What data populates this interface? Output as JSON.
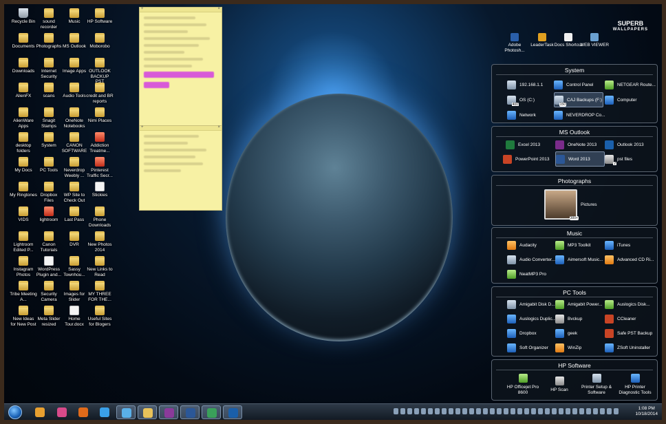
{
  "brand": {
    "line1": "SUPERB",
    "line2": "WALLPAPERS"
  },
  "desktop_icons": [
    {
      "label": "Recycle Bin",
      "icon": "recycle-bin-icon",
      "kind": "bin"
    },
    {
      "label": "sound recorder",
      "icon": "folder-icon",
      "kind": "folder"
    },
    {
      "label": "Music",
      "icon": "folder-icon",
      "kind": "folder"
    },
    {
      "label": "HP Software",
      "icon": "folder-icon",
      "kind": "folder"
    },
    {
      "label": "Documents",
      "icon": "folder-icon",
      "kind": "folder"
    },
    {
      "label": "Photographs",
      "icon": "folder-icon",
      "kind": "folder"
    },
    {
      "label": "MS Outlook",
      "icon": "folder-icon",
      "kind": "folder"
    },
    {
      "label": "Moborobo",
      "icon": "folder-icon",
      "kind": "folder"
    },
    {
      "label": "Downloads",
      "icon": "folder-icon",
      "kind": "folder"
    },
    {
      "label": "Internet Security",
      "icon": "folder-icon",
      "kind": "folder"
    },
    {
      "label": "Image Apps",
      "icon": "folder-icon",
      "kind": "folder"
    },
    {
      "label": "OUTLOOK BACKUP PST",
      "icon": "folder-icon",
      "kind": "folder"
    },
    {
      "label": "AlienFX",
      "icon": "folder-icon",
      "kind": "folder"
    },
    {
      "label": "scans",
      "icon": "folder-icon",
      "kind": "folder"
    },
    {
      "label": "Audio Tools",
      "icon": "folder-icon",
      "kind": "folder"
    },
    {
      "label": "credit and BR reports",
      "icon": "folder-icon",
      "kind": "folder"
    },
    {
      "label": "AlienWare Apps",
      "icon": "folder-icon",
      "kind": "folder"
    },
    {
      "label": "Snagit Stamps",
      "icon": "folder-icon",
      "kind": "folder"
    },
    {
      "label": "OneNote Notebooks",
      "icon": "folder-icon",
      "kind": "folder"
    },
    {
      "label": "Nimi Places",
      "icon": "folder-icon",
      "kind": "folder"
    },
    {
      "label": "desktop folders",
      "icon": "folder-icon",
      "kind": "folder"
    },
    {
      "label": "System",
      "icon": "folder-icon",
      "kind": "folder"
    },
    {
      "label": "CANON SOFTWARE",
      "icon": "folder-icon",
      "kind": "folder"
    },
    {
      "label": "Addiction Treatme...",
      "icon": "chrome-icon",
      "kind": "red"
    },
    {
      "label": "My Docs",
      "icon": "folder-icon",
      "kind": "folder"
    },
    {
      "label": "PC Tools",
      "icon": "folder-icon",
      "kind": "folder"
    },
    {
      "label": "Neverdrop Weebly ...",
      "icon": "folder-icon",
      "kind": "folder"
    },
    {
      "label": "Pinterest Traffic Secr...",
      "icon": "chrome-icon",
      "kind": "red"
    },
    {
      "label": "My Ringtones",
      "icon": "folder-icon",
      "kind": "folder"
    },
    {
      "label": "Dropbox Files",
      "icon": "folder-icon",
      "kind": "folder"
    },
    {
      "label": "WP Site to Check Out",
      "icon": "folder-icon",
      "kind": "folder"
    },
    {
      "label": "Stickies",
      "icon": "stickies-icon",
      "kind": "doc"
    },
    {
      "label": "VIDS",
      "icon": "folder-icon",
      "kind": "folder"
    },
    {
      "label": "lightroom",
      "icon": "lightroom-icon",
      "kind": "red"
    },
    {
      "label": "Last Pass",
      "icon": "folder-icon",
      "kind": "folder"
    },
    {
      "label": "Phone Downloads",
      "icon": "folder-icon",
      "kind": "folder"
    },
    {
      "label": "Lightroom Edited P...",
      "icon": "folder-icon",
      "kind": "folder"
    },
    {
      "label": "Canon Tutorials",
      "icon": "folder-icon",
      "kind": "folder"
    },
    {
      "label": "DVR",
      "icon": "folder-icon",
      "kind": "folder"
    },
    {
      "label": "New Photos 2014",
      "icon": "folder-icon",
      "kind": "folder"
    },
    {
      "label": "Instagram Photos",
      "icon": "folder-icon",
      "kind": "folder"
    },
    {
      "label": "WordPress Plugin and...",
      "icon": "document-icon",
      "kind": "doc"
    },
    {
      "label": "Sassy Townhou...",
      "icon": "folder-icon",
      "kind": "folder"
    },
    {
      "label": "New Links to Read",
      "icon": "folder-icon",
      "kind": "folder"
    },
    {
      "label": "Tribe Meeting A...",
      "icon": "folder-icon",
      "kind": "folder"
    },
    {
      "label": "Security Camera",
      "icon": "folder-icon",
      "kind": "folder"
    },
    {
      "label": "Images for Slider",
      "icon": "folder-icon",
      "kind": "folder"
    },
    {
      "label": "MY THREE FOR THE...",
      "icon": "folder-icon",
      "kind": "folder"
    },
    {
      "label": "New Ideas for New Post",
      "icon": "folder-icon",
      "kind": "folder"
    },
    {
      "label": "Meta Slider resized",
      "icon": "folder-icon",
      "kind": "folder"
    },
    {
      "label": "Home Tour.docx",
      "icon": "word-doc-icon",
      "kind": "doc"
    },
    {
      "label": "Useful Sites for Blogers",
      "icon": "folder-icon",
      "kind": "folder"
    }
  ],
  "top_shortcuts": [
    {
      "label": "Adobe Photosh...",
      "icon": "photoshop-icon"
    },
    {
      "label": "LeaderTask",
      "icon": "leadertask-icon"
    },
    {
      "label": "Docs Shortcut",
      "icon": "docs-icon"
    },
    {
      "label": "WEB VIEWER",
      "icon": "web-viewer-icon"
    }
  ],
  "fences": {
    "system": {
      "title": "System",
      "items": [
        {
          "label": "192.168.1.1",
          "icon": "network-address-icon",
          "kind": "gen"
        },
        {
          "label": "Control Panel",
          "icon": "control-panel-icon",
          "kind": "blue"
        },
        {
          "label": "NETGEAR Route...",
          "icon": "netgear-icon",
          "kind": "green"
        },
        {
          "label": "OS (C:)",
          "icon": "drive-icon",
          "kind": "gen",
          "badge": "400"
        },
        {
          "label": "CAJ Backups (F:)",
          "icon": "drive-icon",
          "kind": "gen",
          "badge": "150",
          "selected": true
        },
        {
          "label": "Computer",
          "icon": "computer-icon",
          "kind": "blue"
        },
        {
          "label": "Network",
          "icon": "network-icon",
          "kind": "blue"
        },
        {
          "label": "NEVERDROP Co...",
          "icon": "neverdrop-icon",
          "kind": "blue"
        }
      ]
    },
    "outlook": {
      "title": "MS Outlook",
      "items": [
        {
          "label": "Excel 2013",
          "icon": "excel-icon",
          "kind": "xl"
        },
        {
          "label": "OneNote 2013",
          "icon": "onenote-icon",
          "kind": "on"
        },
        {
          "label": "Outlook 2013",
          "icon": "outlook-icon",
          "kind": "ol"
        },
        {
          "label": "PowerPoint 2013",
          "icon": "powerpoint-icon",
          "kind": "pp"
        },
        {
          "label": "Word 2013",
          "icon": "word-icon",
          "kind": "wd",
          "selected": true
        },
        {
          "label": "pst files",
          "icon": "pst-files-icon",
          "kind": "gray",
          "badge": "2"
        }
      ]
    },
    "photographs": {
      "title": "Photographs",
      "items": [
        {
          "label": "Pictures",
          "icon": "pictures-icon",
          "kind": "thumb",
          "badge": "300+"
        }
      ]
    },
    "music": {
      "title": "Music",
      "items": [
        {
          "label": "Audacity",
          "icon": "audacity-icon",
          "kind": "orange"
        },
        {
          "label": "MP3 Toolkit",
          "icon": "mp3-toolkit-icon",
          "kind": "green"
        },
        {
          "label": "iTunes",
          "icon": "itunes-icon",
          "kind": "blue"
        },
        {
          "label": "Audio Converter...",
          "icon": "audio-converter-icon",
          "kind": "gen"
        },
        {
          "label": "Aimersoft Music...",
          "icon": "aimersoft-icon",
          "kind": "blue"
        },
        {
          "label": "Advanced CD Ri...",
          "icon": "cd-ripper-icon",
          "kind": "orange"
        },
        {
          "label": "NeatMP3 Pro",
          "icon": "neatmp3-icon",
          "kind": "green"
        }
      ]
    },
    "pctools": {
      "title": "PC Tools",
      "items": [
        {
          "label": "Amigabit Disk D...",
          "icon": "amigabit-disk-icon",
          "kind": "gen"
        },
        {
          "label": "Amigabit Power...",
          "icon": "amigabit-power-icon",
          "kind": "green"
        },
        {
          "label": "Auslogics Disk...",
          "icon": "auslogics-disk-icon",
          "kind": "green"
        },
        {
          "label": "Auslogics Duplic...",
          "icon": "auslogics-duplicate-icon",
          "kind": "blue"
        },
        {
          "label": "Bvckup",
          "icon": "bvckup-icon",
          "kind": "gray"
        },
        {
          "label": "CCleaner",
          "icon": "ccleaner-icon",
          "kind": "pp"
        },
        {
          "label": "Dropbox",
          "icon": "dropbox-icon",
          "kind": "blue"
        },
        {
          "label": "geek",
          "icon": "geek-icon",
          "kind": "blue"
        },
        {
          "label": "Safe PST Backup",
          "icon": "safe-pst-icon",
          "kind": "pp"
        },
        {
          "label": "Soft Organizer",
          "icon": "soft-organizer-icon",
          "kind": "blue"
        },
        {
          "label": "WinZip",
          "icon": "winzip-icon",
          "kind": "orange"
        },
        {
          "label": "ZSoft Uninstaller",
          "icon": "zsoft-icon",
          "kind": "blue"
        }
      ]
    },
    "hpsoftware": {
      "title": "HP Software",
      "items": [
        {
          "label": "HP Officejet Pro 8600",
          "icon": "hp-officejet-icon",
          "kind": "green"
        },
        {
          "label": "HP Scan",
          "icon": "hp-scan-icon",
          "kind": "gray"
        },
        {
          "label": "Printer Setup & Software",
          "icon": "printer-setup-icon",
          "kind": "gen"
        },
        {
          "label": "HP Printer Diagnostic Tools",
          "icon": "hp-diagnostic-icon",
          "kind": "blue"
        }
      ]
    }
  },
  "taskbar": {
    "buttons": [
      {
        "icon": "media-player-icon",
        "color": "#e8a030"
      },
      {
        "icon": "paint-icon",
        "color": "#d84a8a"
      },
      {
        "icon": "firefox-icon",
        "color": "#e06a1a"
      },
      {
        "icon": "internet-explorer-icon",
        "color": "#3aa0e8"
      },
      {
        "icon": "control-panel-icon",
        "color": "#5ab0e8",
        "active": true
      },
      {
        "icon": "explorer-icon",
        "color": "#e8c25a",
        "active": true
      },
      {
        "icon": "onenote-icon",
        "color": "#8a3a9a",
        "active": true
      },
      {
        "icon": "word-icon",
        "color": "#2b5797",
        "active": true
      },
      {
        "icon": "chrome-icon",
        "color": "#3aa05a",
        "active": true
      },
      {
        "icon": "outlook-icon",
        "color": "#1a5faa",
        "active": true
      }
    ],
    "time": "1:08 PM",
    "date": "10/18/2014"
  }
}
